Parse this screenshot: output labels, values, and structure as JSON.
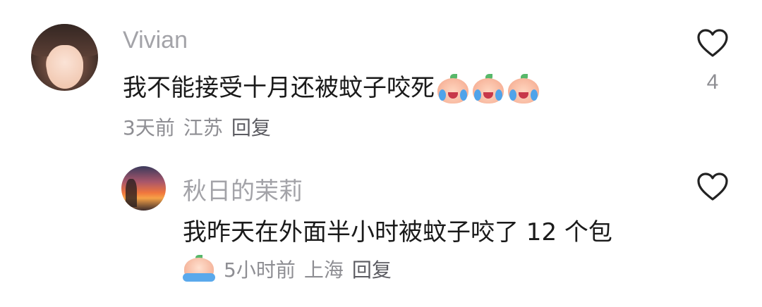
{
  "comment": {
    "username": "Vivian",
    "text": "我不能接受十月还被蚊子咬死",
    "emoji_count": 3,
    "emoji_icon": "crying-peach-emoji-icon",
    "time": "3天前",
    "location": "江苏",
    "reply_label": "回复",
    "likes": "4"
  },
  "reply": {
    "username": "秋日的茉莉",
    "text": "我昨天在外面半小时被蚊子咬了 12 个包",
    "meta_icon": "crying-peach-emoji-icon",
    "time": "5小时前",
    "location": "上海",
    "reply_label": "回复"
  },
  "colors": {
    "username": "#a3a3a8",
    "text": "#1a1a1a",
    "meta": "#8e8e93",
    "icon_stroke": "#1a1a1a"
  }
}
